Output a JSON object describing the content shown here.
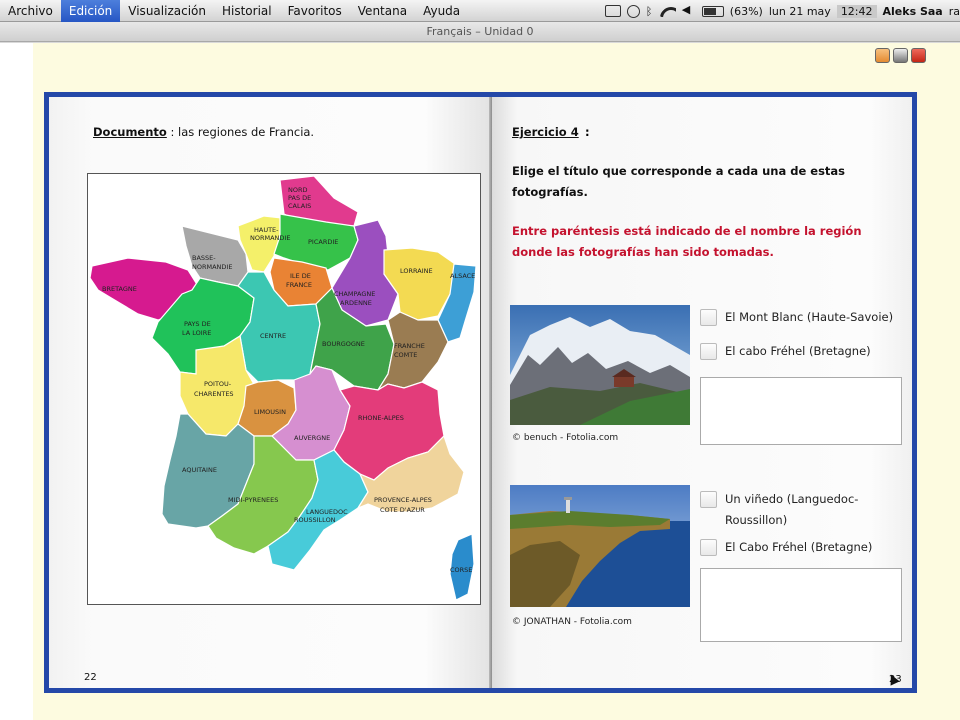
{
  "menubar": {
    "items": [
      "Archivo",
      "Edición",
      "Visualización",
      "Historial",
      "Favoritos",
      "Ventana",
      "Ayuda"
    ],
    "status": {
      "battery": "(63%)",
      "date": "lun 21 may",
      "time": "12:42",
      "user": "Aleks Saa",
      "trailing": "ra"
    }
  },
  "window": {
    "title": "Français – Unidad 0"
  },
  "left_page": {
    "doc_label": "Documento",
    "doc_rest": " : las regiones de Francia.",
    "page_number": "22",
    "map_regions": {
      "bretagne": "BRETAGNE",
      "basse_normandie_1": "BASSE-",
      "basse_normandie_2": "NORMANDIE",
      "haute_normandie_1": "HAUTE-",
      "haute_normandie_2": "NORMANDIE",
      "nord_1": "NORD",
      "nord_2": "PAS DE",
      "nord_3": "CALAIS",
      "picardie": "PICARDIE",
      "ile_1": "ILE DE",
      "ile_2": "FRANCE",
      "champagne_1": "CHAMPAGNE",
      "champagne_2": "ARDENNE",
      "lorraine": "LORRAINE",
      "alsace": "ALSACE",
      "pays_1": "PAYS DE",
      "pays_2": "LA LOIRE",
      "centre": "CENTRE",
      "bourgogne": "BOURGOGNE",
      "franche_1": "FRANCHE",
      "franche_2": "COMTE",
      "poitou_1": "POITOU-",
      "poitou_2": "CHARENTES",
      "limousin": "LIMOUSIN",
      "auvergne": "AUVERGNE",
      "rhone": "RHONE-ALPES",
      "aquitaine": "AQUITAINE",
      "midi": "MIDI-PYRENEES",
      "languedoc_1": "LANGUEDOC",
      "languedoc_2": "ROUSSILLON",
      "provence_1": "PROVENCE-ALPES",
      "provence_2": "COTE D'AZUR",
      "corse": "CORSE"
    },
    "colors": {
      "bretagne": "#d61a8f",
      "basse_normandie": "#a8a8a8",
      "haute_normandie": "#f4f06a",
      "nord": "#e13a8e",
      "picardie": "#36c24a",
      "ile": "#e98334",
      "champagne": "#9b4fbf",
      "lorraine": "#f3da52",
      "alsace": "#3d9fd6",
      "pays": "#20c25a",
      "centre": "#3cc7b2",
      "bourgogne": "#3fa34a",
      "franche": "#9a7c52",
      "poitou": "#f6e86a",
      "limousin": "#d99240",
      "auvergne": "#d68fd0",
      "rhone": "#e33c7a",
      "aquitaine": "#68a5a6",
      "midi": "#86c84e",
      "languedoc": "#48cbd9",
      "provence": "#f0d49c",
      "corse": "#2a8ccc"
    }
  },
  "right_page": {
    "exercise_title": "Ejercicio 4",
    "exercise_colon": " :",
    "instruction": "Elige el título que corresponde a cada una de estas fotografías.",
    "note": "Entre paréntesis está indicado de el nombre la región donde las fotografías han sido tomadas.",
    "page_number": "23",
    "photo1": {
      "credit": "© benuch - Fotolia.com",
      "option_a": "El Mont Blanc (Haute-Savoie)",
      "option_b": "El cabo Fréhel (Bretagne)",
      "answer_value": ""
    },
    "photo2": {
      "credit": "© JONATHAN - Fotolia.com",
      "option_a_line1": "Un viñedo (Languedoc-",
      "option_a_line2": "Roussillon)",
      "option_b": "El Cabo Fréhel (Bretagne)",
      "answer_value": ""
    }
  }
}
